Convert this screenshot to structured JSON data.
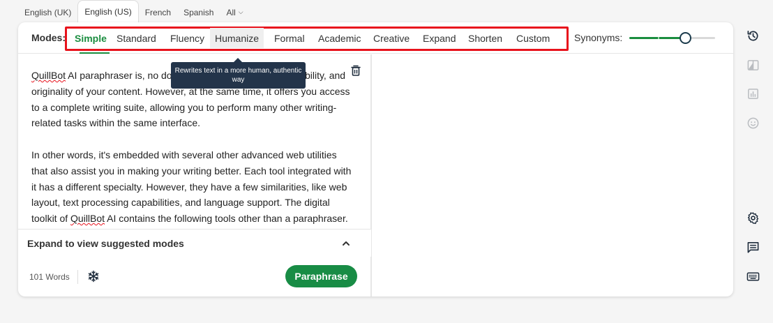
{
  "language_tabs": [
    {
      "label": "English (UK)",
      "active": false
    },
    {
      "label": "English (US)",
      "active": true
    },
    {
      "label": "French",
      "active": false
    },
    {
      "label": "Spanish",
      "active": false
    },
    {
      "label": "All",
      "active": false
    }
  ],
  "modes": {
    "label": "Modes:",
    "items": [
      "Simple",
      "Standard",
      "Fluency",
      "Humanize",
      "Formal",
      "Academic",
      "Creative",
      "Expand",
      "Shorten",
      "Custom"
    ],
    "active": "Simple",
    "hovered": "Humanize"
  },
  "synonyms": {
    "label": "Synonyms:",
    "level": 0.66
  },
  "tooltip": {
    "text": "Rewrites text in a more human, authentic way"
  },
  "editor": {
    "paragraph1": {
      "first_word": "QuillBot",
      "rest": " AI paraphraser is, no doubt, improves the clarity, readability, and originality of your content. However, at the same time, it offers you access to a complete writing suite, allowing you to perform many other writing-related tasks within the same interface."
    },
    "paragraph2": {
      "before": "In other words, it's embedded with several other advanced web utilities that also assist you in making your writing better. Each tool integrated with it has a different specialty. However, they have a few similarities, like web layout, text processing capabilities, and language support. The digital toolkit of ",
      "brand": "QuillBot",
      "after": " AI contains the following tools other than a paraphraser."
    }
  },
  "suggest": {
    "label": "Expand to view suggested modes"
  },
  "footer": {
    "word_count": "101 Words",
    "paraphrase_label": "Paraphrase"
  },
  "colors": {
    "accent": "#1a8d3f",
    "button": "#188c45",
    "highlight_box": "#e8121c",
    "tooltip_bg": "#23344a"
  },
  "rail_icons": [
    "history-icon",
    "compare-icon",
    "stats-icon",
    "emoji-icon",
    "settings-icon",
    "feedback-icon",
    "keyboard-icon"
  ]
}
